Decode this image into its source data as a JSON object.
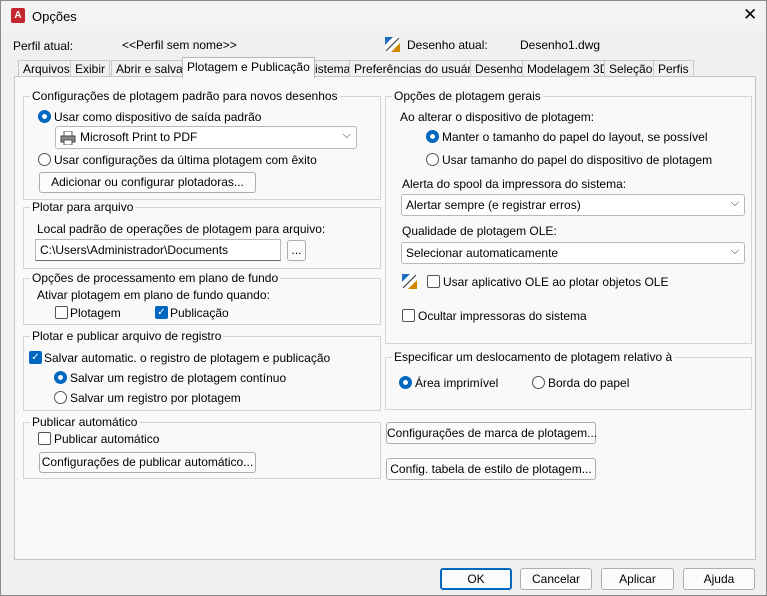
{
  "window": {
    "title": "Opções",
    "app_icon": "autocad-icon"
  },
  "profile": {
    "label": "Perfil atual:",
    "value": "<<Perfil sem nome>>"
  },
  "drawing": {
    "label": "Desenho atual:",
    "value": "Desenho1.dwg"
  },
  "tabs": [
    "Arquivos",
    "Exibir",
    "Abrir e salvar",
    "Plotagem e Publicação",
    "Sistema",
    "Preferências do usuário",
    "Desenho",
    "Modelagem 3D",
    "Seleção",
    "Perfis"
  ],
  "active_tab": "Plotagem e Publicação",
  "default_plot": {
    "title": "Configurações de plotagem padrão para novos desenhos",
    "use_device_label": "Usar como dispositivo de saída padrão",
    "device_value": "Microsoft Print to PDF",
    "use_last_label": "Usar configurações da última plotagem com êxito",
    "add_plotter_button": "Adicionar ou configurar plotadoras..."
  },
  "plot_to_file": {
    "title": "Plotar para arquivo",
    "location_label": "Local padrão de operações de plotagem para arquivo:",
    "location_value": "C:\\Users\\Administrador\\Documents",
    "browse_button": "..."
  },
  "background": {
    "title": "Opções de processamento em plano de fundo",
    "enable_label": "Ativar plotagem em plano de fundo quando:",
    "plotting_label": "Plotagem",
    "publishing_label": "Publicação"
  },
  "log": {
    "title": "Plotar e publicar arquivo de registro",
    "auto_save_label": "Salvar automatic. o registro de plotagem e publicação",
    "continuous_label": "Salvar um registro de plotagem contínuo",
    "per_plot_label": "Salvar um registro por plotagem"
  },
  "auto_publish": {
    "title": "Publicar automático",
    "checkbox_label": "Publicar automático",
    "settings_button": "Configurações de publicar automático..."
  },
  "general": {
    "title": "Opções de plotagem gerais",
    "when_changing_label": "Ao alterar o dispositivo de plotagem:",
    "keep_layout_label": "Manter o tamanho do papel do layout, se possível",
    "use_device_paper_label": "Usar tamanho do papel do dispositivo de plotagem",
    "spool_label": "Alerta do spool da impressora do sistema:",
    "spool_value": "Alertar sempre (e registrar erros)",
    "ole_label": "Qualidade de plotagem OLE:",
    "ole_value": "Selecionar automaticamente",
    "ole_app_label": "Usar aplicativo OLE ao plotar objetos OLE",
    "hide_printers_label": "Ocultar impressoras do sistema"
  },
  "offset": {
    "title": "Especificar um deslocamento de plotagem relativo à",
    "printable_label": "Área imprimível",
    "edge_label": "Borda do papel"
  },
  "buttons": {
    "stamp": "Configurações de marca de plotagem...",
    "style_table": "Config. tabela de estilo de plotagem...",
    "ok": "OK",
    "cancel": "Cancelar",
    "apply": "Aplicar",
    "help": "Ajuda"
  },
  "colors": {
    "accent": "#0067c0",
    "app_red": "#c4262e"
  }
}
